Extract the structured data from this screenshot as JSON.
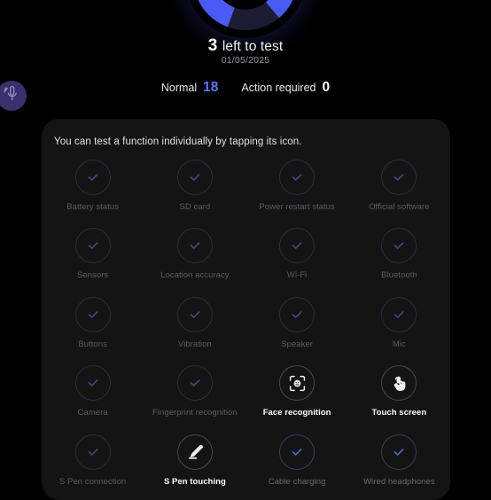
{
  "header": {
    "ring": {
      "icon_name": "progress-ring",
      "percent": 86,
      "accent_color": "#4a5bf5",
      "track_color": "#1a1d33"
    },
    "remaining_count": "3",
    "remaining_text": " left to test",
    "date": "01/05/2025",
    "stats": [
      {
        "label": "Normal",
        "value": "18",
        "value_color": "#5a77ff"
      },
      {
        "label": "Action required",
        "value": "0",
        "value_color": "#ffffff"
      }
    ]
  },
  "assistant_badge": {
    "icon_name": "microphone-icon",
    "background_color": "#3b2f6e"
  },
  "card": {
    "hint": "You can test a function individually by tapping its icon.",
    "background_color": "#141415",
    "tiles": [
      {
        "label": "Battery status",
        "icon_name": "check-icon",
        "state": "tested"
      },
      {
        "label": "SD card",
        "icon_name": "check-icon",
        "state": "tested"
      },
      {
        "label": "Power restart status",
        "icon_name": "check-icon",
        "state": "tested"
      },
      {
        "label": "Official software",
        "icon_name": "check-icon",
        "state": "tested"
      },
      {
        "label": "Sensors",
        "icon_name": "check-icon",
        "state": "tested"
      },
      {
        "label": "Location accuracy",
        "icon_name": "check-icon",
        "state": "tested"
      },
      {
        "label": "Wi-Fi",
        "icon_name": "check-icon",
        "state": "tested"
      },
      {
        "label": "Bluetooth",
        "icon_name": "check-icon",
        "state": "tested"
      },
      {
        "label": "Buttons",
        "icon_name": "check-icon",
        "state": "tested"
      },
      {
        "label": "Vibration",
        "icon_name": "check-icon",
        "state": "tested"
      },
      {
        "label": "Speaker",
        "icon_name": "check-icon",
        "state": "tested"
      },
      {
        "label": "Mic",
        "icon_name": "check-icon",
        "state": "tested"
      },
      {
        "label": "Camera",
        "icon_name": "check-icon",
        "state": "tested"
      },
      {
        "label": "Fingerprint recognition",
        "icon_name": "check-icon",
        "state": "tested"
      },
      {
        "label": "Face recognition",
        "icon_name": "face-scan-icon",
        "state": "untested"
      },
      {
        "label": "Touch screen",
        "icon_name": "tap-hand-icon",
        "state": "untested"
      },
      {
        "label": "S Pen connection",
        "icon_name": "check-icon",
        "state": "tested"
      },
      {
        "label": "S Pen touching",
        "icon_name": "stylus-pen-icon",
        "state": "untested"
      },
      {
        "label": "Cable charging",
        "icon_name": "check-icon",
        "state": "tested-bright"
      },
      {
        "label": "Wired headphones",
        "icon_name": "check-icon",
        "state": "tested-bright"
      }
    ]
  }
}
